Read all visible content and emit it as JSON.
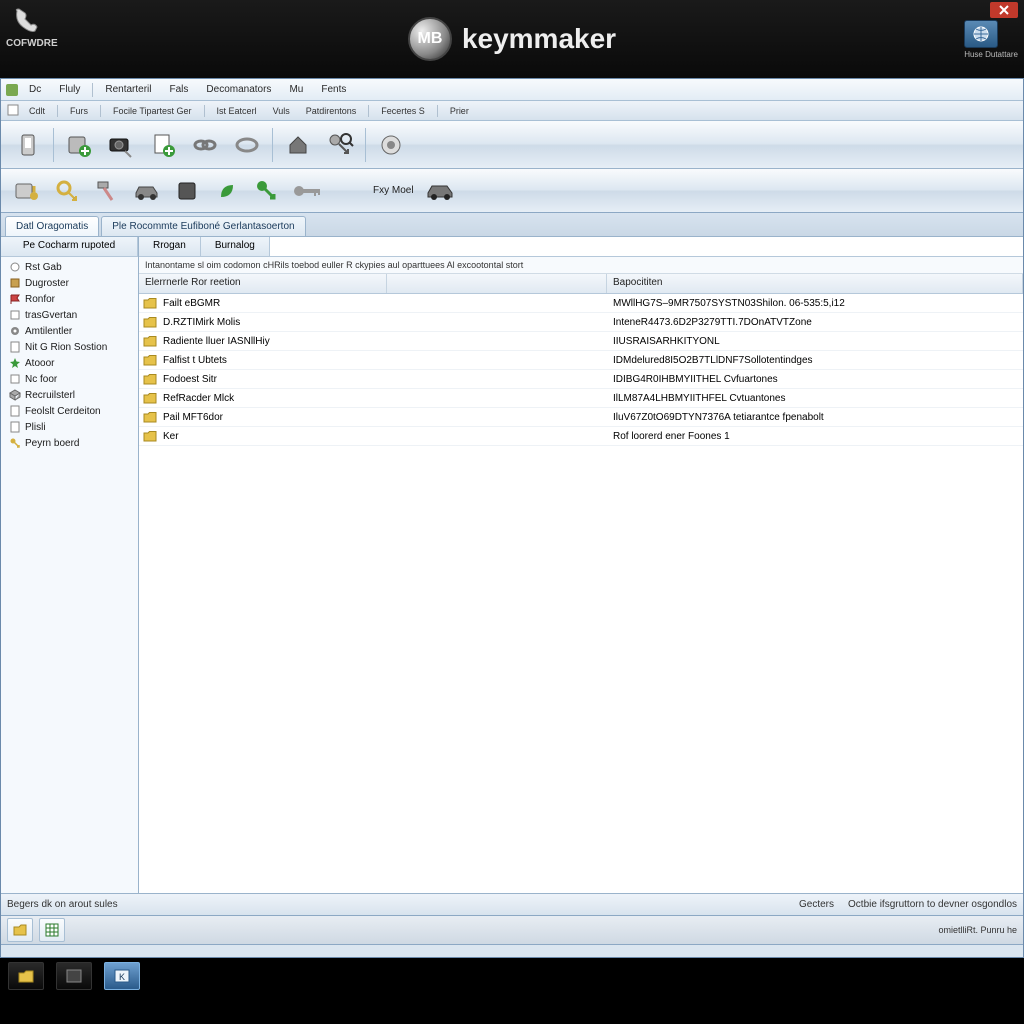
{
  "header": {
    "left_label": "COFWDRE",
    "app_name": "keymmaker",
    "logo_text": "MB",
    "right_label": "Huse Dutattare"
  },
  "menubar": [
    "Dc",
    "Fluly",
    "Rentarteril",
    "Fals",
    "Decomanators",
    "Mu",
    "Fents"
  ],
  "submenubar": [
    "Cdlt",
    "Furs",
    "Focile Tipartest Ger",
    "Ist Eatcerl",
    "Vuls",
    "Patdirentons",
    "Fecertes  S",
    "Prier"
  ],
  "toolbar1_icons": [
    "device-icon",
    "drive-add-icon",
    "camera-key-icon",
    "doc-add-icon",
    "link-icon",
    "ring-icon",
    "",
    "home-icon",
    "key-search-icon",
    "",
    "target-icon"
  ],
  "toolbar2_icons": [
    "hdd-key-icon",
    "keyring-icon",
    "hammer-icon",
    "car-icon",
    "box-icon",
    "leaf-icon",
    "",
    "key-green-icon",
    "key-grey-icon",
    "",
    "",
    "key-moel-label",
    "car2-icon"
  ],
  "toolbar2_label": "Fxy Moel",
  "tabs": [
    "Datl Oragomatis",
    "Ple Rocommte Eufiboné Gerlantasoerton"
  ],
  "sidebar": {
    "title": "Pe Cocharm rupoted",
    "panel_tabs": [
      "Rrogan",
      "Burnalog"
    ],
    "items": [
      {
        "icon": "circle",
        "label": "Rst Gab"
      },
      {
        "icon": "box",
        "label": "Dugroster"
      },
      {
        "icon": "flag",
        "label": "Ronfor"
      },
      {
        "icon": "square",
        "label": "trasGvertan"
      },
      {
        "icon": "gear",
        "label": "Amtilentler"
      },
      {
        "icon": "doc",
        "label": "Nit G Rion Sostion"
      },
      {
        "icon": "star",
        "label": "Atooor"
      },
      {
        "icon": "square",
        "label": "Nc foor"
      },
      {
        "icon": "cube",
        "label": "Recruilsterl"
      },
      {
        "icon": "doc",
        "label": "Feolslt Cerdeiton"
      },
      {
        "icon": "doc",
        "label": "Plisli"
      },
      {
        "icon": "key",
        "label": "Peyrn boerd"
      }
    ]
  },
  "main": {
    "info_text": "Intanontame sl oim codomon cHRils toebod euller   R ckypies aul oparttuees Al excootontal stort",
    "columns": [
      "Elerrnerle Ror reetion",
      "",
      "Bapocititen"
    ],
    "rows": [
      {
        "name": "Failt  eBGMR",
        "desc": "MWllHG7S–9MR7507SYSTN03Shilon. 06-535:5,i12"
      },
      {
        "name": "D.RZTIMirk Molis",
        "desc": "InteneR4473.6D2P3279TTI.7DOnATVTZone"
      },
      {
        "name": "Radiente lluer IASNllHiy",
        "desc": "IIUSRAISARHKITYONL"
      },
      {
        "name": "Falfist t Ubtets",
        "desc": "IDMdelured8I5O2B7TLlDNF7Sollotentindges"
      },
      {
        "name": "Fodoest Sitr",
        "desc": "IDIBG4R0IHBMYIITHEL Cvfuartones"
      },
      {
        "name": "RefRacder Mlck",
        "desc": "IlLM87A4LHBMYIITHFEL Cvtuantones"
      },
      {
        "name": "Pail MFT6dor",
        "desc": "IluV67Z0tO69DTYN7376A tetiarantce fpenabolt"
      },
      {
        "name": "Ker",
        "desc": "Rof loorerd ener Foones 1"
      }
    ]
  },
  "statusbar": {
    "left": "Begers dk on arout sules",
    "mid": "Gecters",
    "right": "Octbie ifsgruttorn to devner osgondlos"
  },
  "tray": {
    "right_text": "omietlliRt. Punru he"
  }
}
